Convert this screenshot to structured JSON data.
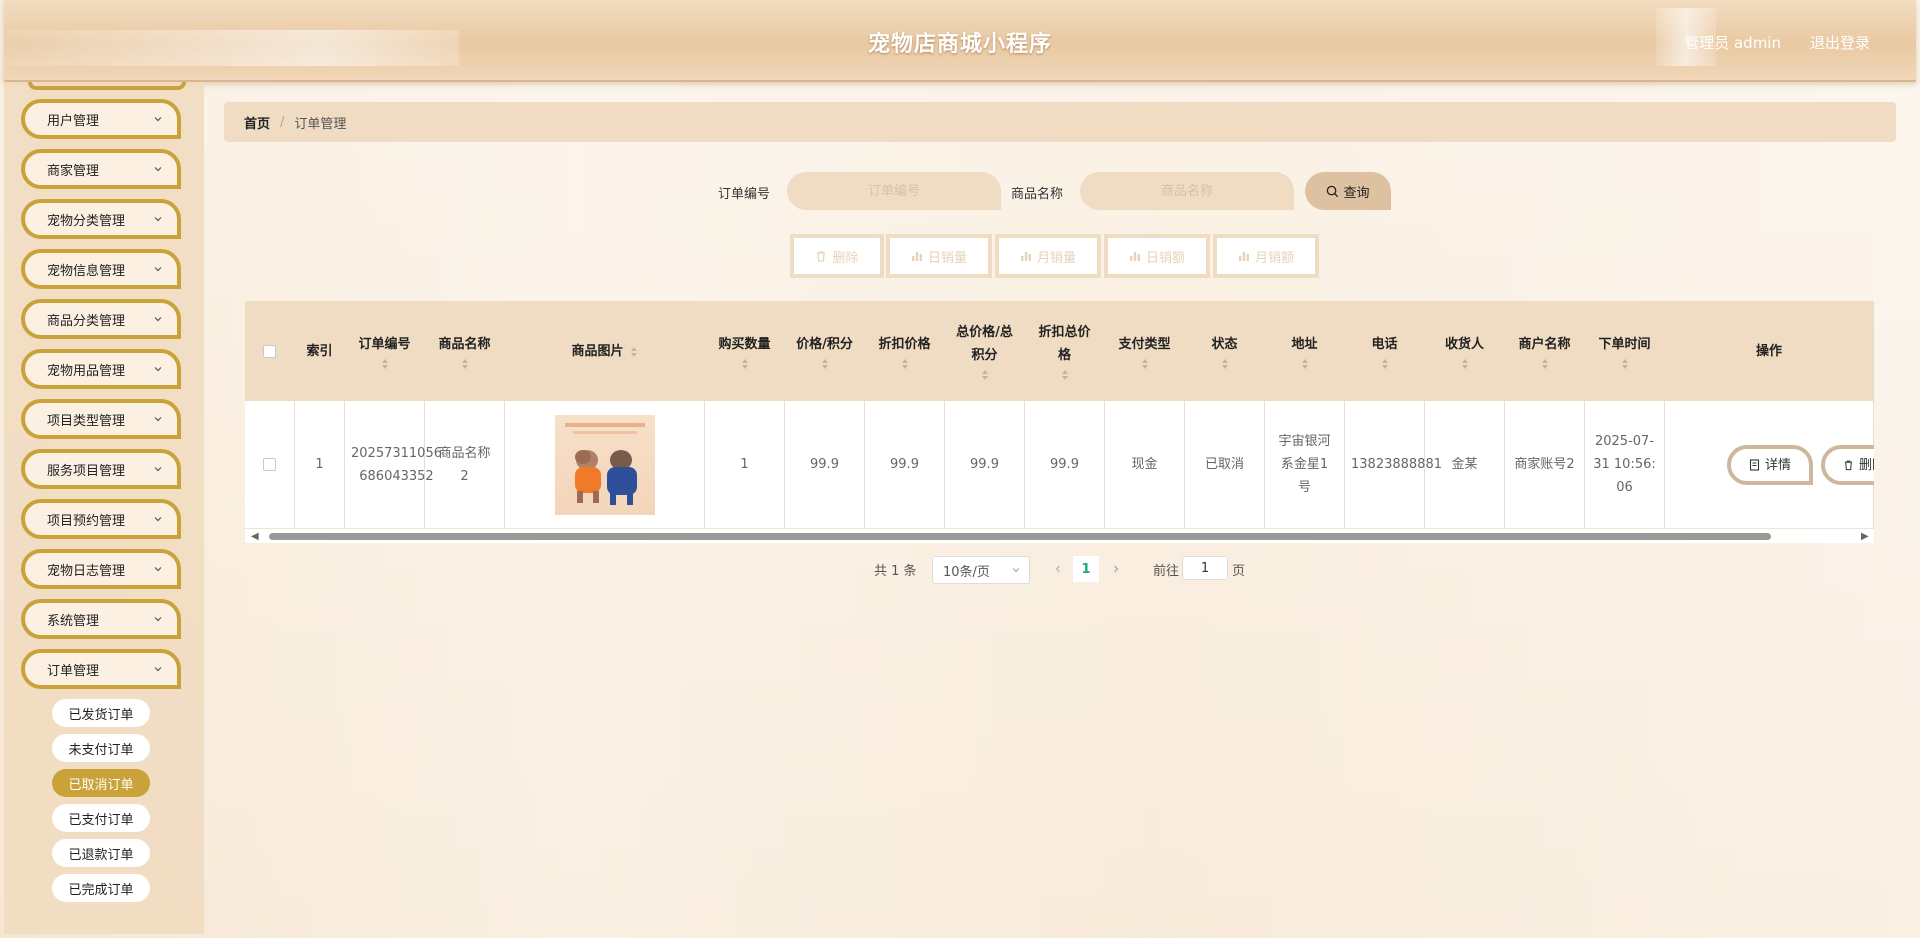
{
  "header": {
    "title": "宠物店商城小程序",
    "user_label": "管理员 admin",
    "logout_label": "退出登录"
  },
  "sidebar": {
    "menus": [
      {
        "label": "用户管理"
      },
      {
        "label": "商家管理"
      },
      {
        "label": "宠物分类管理"
      },
      {
        "label": "宠物信息管理"
      },
      {
        "label": "商品分类管理"
      },
      {
        "label": "宠物用品管理"
      },
      {
        "label": "项目类型管理"
      },
      {
        "label": "服务项目管理"
      },
      {
        "label": "项目预约管理"
      },
      {
        "label": "宠物日志管理"
      },
      {
        "label": "系统管理"
      },
      {
        "label": "订单管理"
      }
    ],
    "submenus": [
      {
        "label": "已发货订单"
      },
      {
        "label": "未支付订单"
      },
      {
        "label": "已取消订单"
      },
      {
        "label": "已支付订单"
      },
      {
        "label": "已退款订单"
      },
      {
        "label": "已完成订单"
      }
    ],
    "active_submenu": "已取消订单"
  },
  "breadcrumb": {
    "home": "首页",
    "separator": "/",
    "current": "订单管理"
  },
  "search": {
    "order_no_label": "订单编号",
    "order_no_placeholder": "订单编号",
    "goods_name_label": "商品名称",
    "goods_name_placeholder": "商品名称",
    "query_label": "查询"
  },
  "actions": {
    "delete": "删除",
    "daily_sales_qty": "日销量",
    "monthly_sales_qty": "月销量",
    "daily_sales_amount": "日销额",
    "monthly_sales_amount": "月销额"
  },
  "table": {
    "columns": {
      "index": "索引",
      "order_no": "订单编号",
      "goods_name": "商品名称",
      "goods_image": "商品图片",
      "quantity": "购买数量",
      "price": "价格/积分",
      "discount_price": "折扣价格",
      "total": "总价格/总积分",
      "discount_total": "折扣总价格",
      "pay_type": "支付类型",
      "status": "状态",
      "address": "地址",
      "phone": "电话",
      "receiver": "收货人",
      "merchant": "商户名称",
      "order_time": "下单时间",
      "operation": "操作"
    },
    "rows": [
      {
        "index": "1",
        "order_no": "20257311056686043352",
        "goods_name": "商品名称2",
        "quantity": "1",
        "price": "99.9",
        "discount_price": "99.9",
        "total": "99.9",
        "discount_total": "99.9",
        "pay_type": "现金",
        "status": "已取消",
        "address": "宇宙银河系金星1号",
        "phone": "13823888881",
        "receiver": "金某",
        "merchant": "商家账号2",
        "order_time": "2025-07-31 10:56:06",
        "detail_label": "详情",
        "delete_label": "删除"
      }
    ]
  },
  "pagination": {
    "total_text": "共 1 条",
    "page_size": "10条/页",
    "current_page": "1",
    "goto_label": "前往",
    "goto_value": "1",
    "page_unit": "页"
  },
  "colors": {
    "accent_gold": "#c9a23a",
    "header_tan": "#efdcc2",
    "active_page": "#1aa97b"
  }
}
